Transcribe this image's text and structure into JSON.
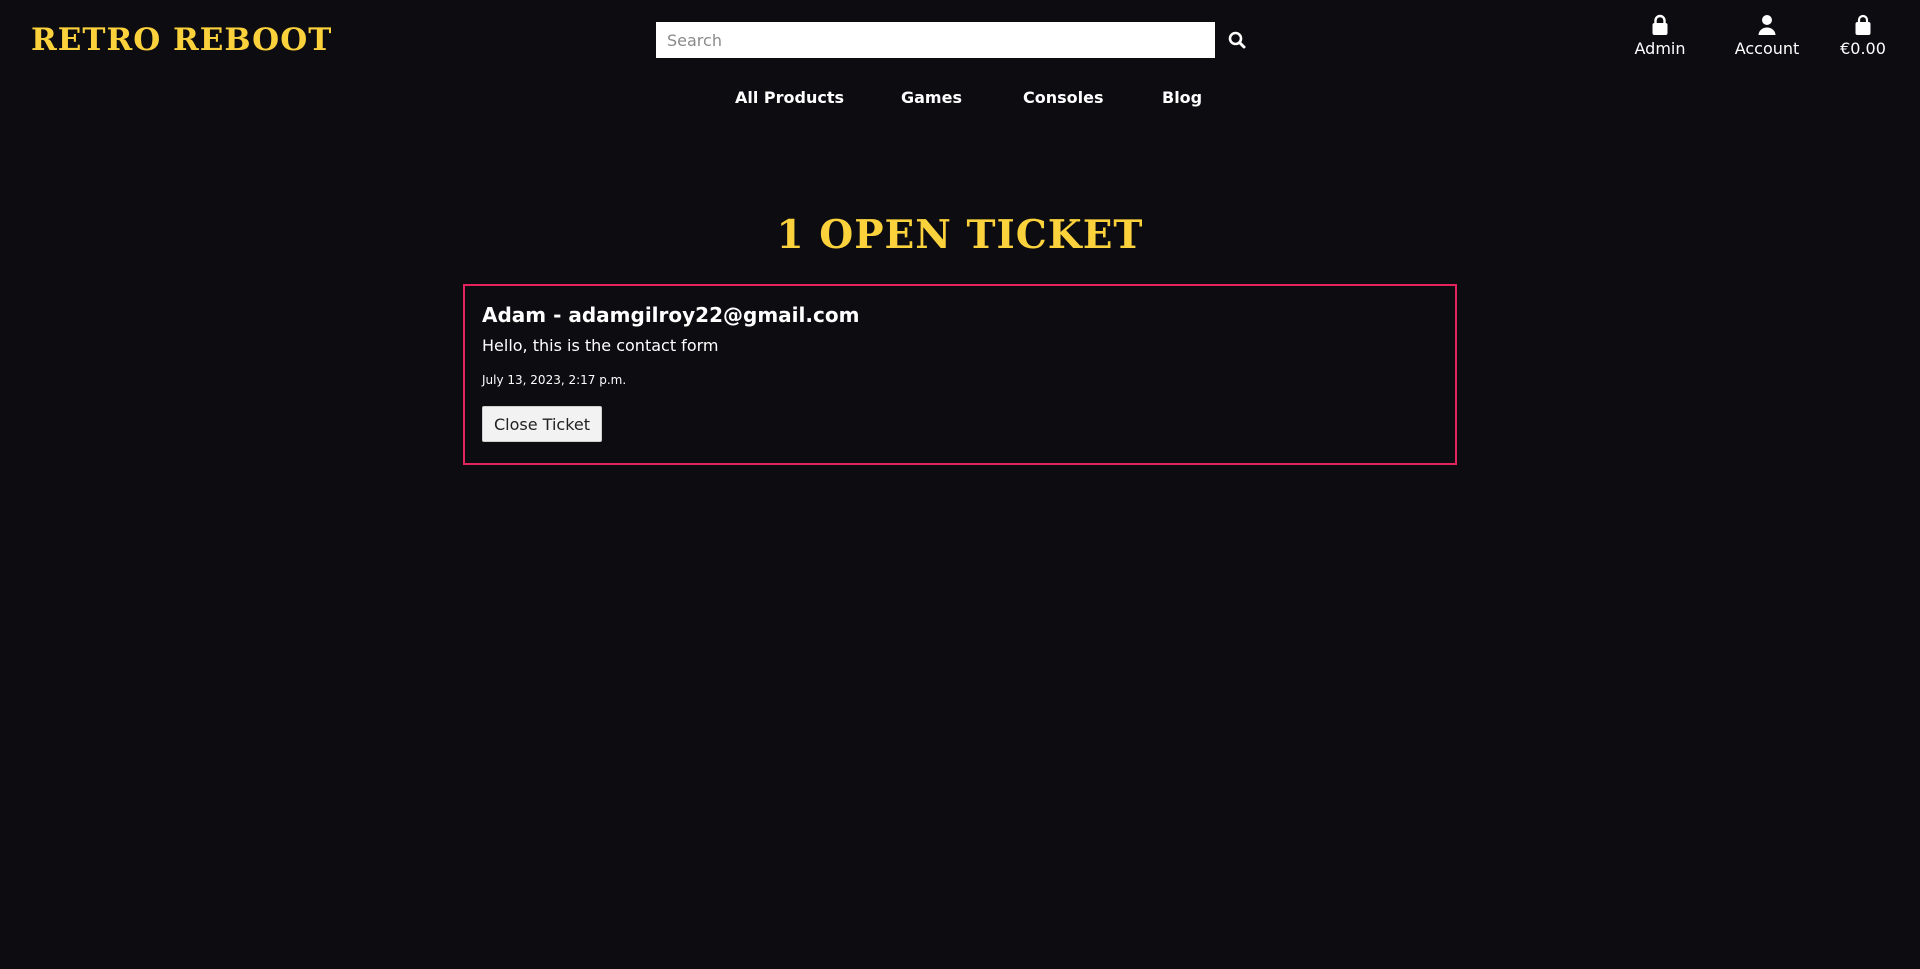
{
  "header": {
    "logo": "RETRO REBOOT",
    "search": {
      "placeholder": "Search",
      "value": ""
    },
    "links": {
      "admin": {
        "label": "Admin",
        "icon": "lock-icon"
      },
      "account": {
        "label": "Account",
        "icon": "user-icon"
      },
      "cart": {
        "label": "€0.00",
        "icon": "shopping-bag-icon"
      }
    }
  },
  "nav": {
    "items": [
      "All Products",
      "Games",
      "Consoles",
      "Blog"
    ]
  },
  "main": {
    "title": "1 OPEN TICKET",
    "tickets": [
      {
        "heading": "Adam - adamgilroy22@gmail.com",
        "message": "Hello, this is the contact form",
        "date": "July 13, 2023, 2:17 p.m.",
        "close_label": "Close Ticket"
      }
    ]
  },
  "colors": {
    "background": "#0c0c11",
    "accent_yellow": "#fcd23c",
    "ticket_border": "#e5245f",
    "text": "#ffffff"
  }
}
